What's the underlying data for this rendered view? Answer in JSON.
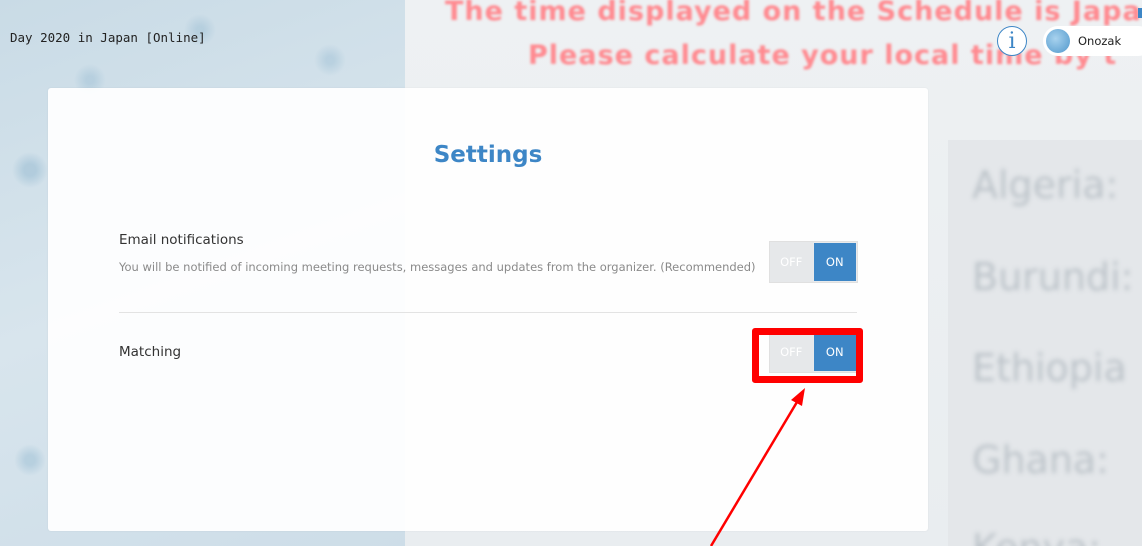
{
  "header": {
    "event_title": "Day 2020 in Japan [Online]",
    "info_icon": "i",
    "user_name": "Onozak"
  },
  "background": {
    "notice_line1": "The time displayed on the Schedule is Japan",
    "notice_line2": "Please calculate your local time by t",
    "countries": [
      "Algeria:",
      "Burundi:",
      "Ethiopia",
      "Ghana:",
      "Kenya:"
    ]
  },
  "settings": {
    "title": "Settings",
    "email": {
      "label": "Email notifications",
      "description": "You will be notified of incoming meeting requests, messages and updates from the organizer. (Recommended)",
      "off_label": "OFF",
      "on_label": "ON",
      "value": "ON"
    },
    "matching": {
      "label": "Matching",
      "off_label": "OFF",
      "on_label": "ON",
      "value": "ON"
    }
  },
  "colors": {
    "accent": "#3d86c6",
    "annotation": "#ff0000"
  },
  "icons": {
    "info": "info-icon",
    "avatar": "avatar"
  }
}
